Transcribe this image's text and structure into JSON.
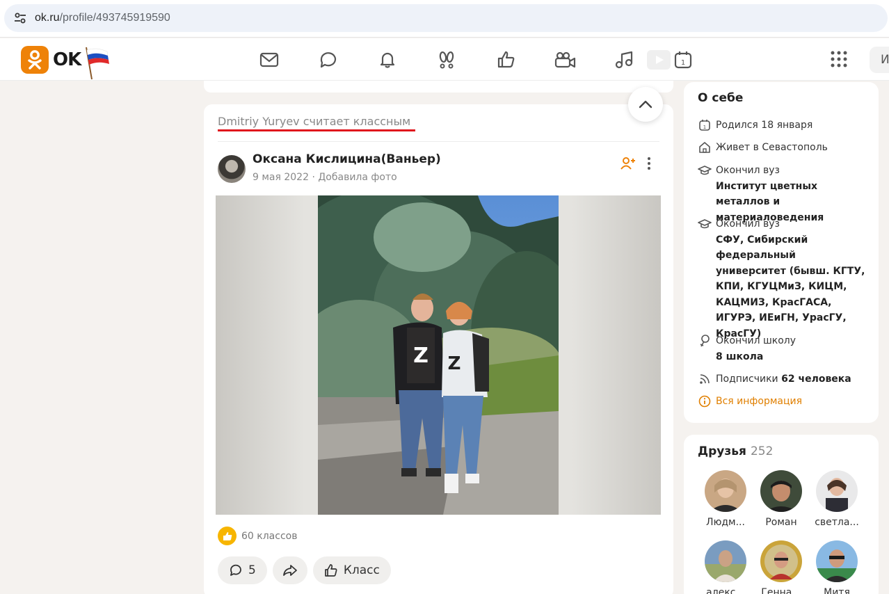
{
  "browser": {
    "url_host": "ok.ru",
    "url_path": "/profile/493745919590"
  },
  "toolbar": {
    "logo_text": "OK",
    "nav_icons": [
      "mail-icon",
      "chat-icon",
      "bell-icon",
      "guests-icon",
      "like-icon",
      "video-call-icon",
      "music-icon",
      "video-icon",
      "calendar-icon"
    ],
    "search_stub": "И"
  },
  "post": {
    "header": "Dmitriy Yuryev считает классным",
    "author": "Оксана Кислицина(Ваньер)",
    "date": "9 мая 2022",
    "meta_separator": "·",
    "action": "Добавила фото",
    "likes": "60 классов",
    "comments": "5",
    "like_button": "Класс"
  },
  "about": {
    "title": "О себе",
    "born": "Родился 18 января",
    "lives": "Живет в Севастополь",
    "uni1_label": "Окончил вуз",
    "uni1_name": "Институт цветных металлов и материаловедения",
    "uni2_label": "Окончил вуз",
    "uni2_name": "СФУ, Сибирский федеральный университет (бывш. КГТУ, КПИ, КГУЦМиЗ, КИЦМ, КАЦМИЗ, КрасГАСА, ИГУРЭ, ИЕиГН, УрасГУ, КрасГУ)",
    "school_label": "Окончил школу",
    "school_name": "8 школа",
    "subscribers_label": "Подписчики",
    "subscribers_value": "62 человека",
    "all_info": "Вся информация"
  },
  "friends": {
    "title": "Друзья",
    "count": "252",
    "list": [
      {
        "name": "Людм..."
      },
      {
        "name": "Роман"
      },
      {
        "name": "светла..."
      },
      {
        "name": "алекс..."
      },
      {
        "name": "Генна..."
      },
      {
        "name": "Митя"
      }
    ]
  },
  "colors": {
    "brand": "#ee8208",
    "underline": "#e0151c",
    "link": "#e07f00"
  }
}
